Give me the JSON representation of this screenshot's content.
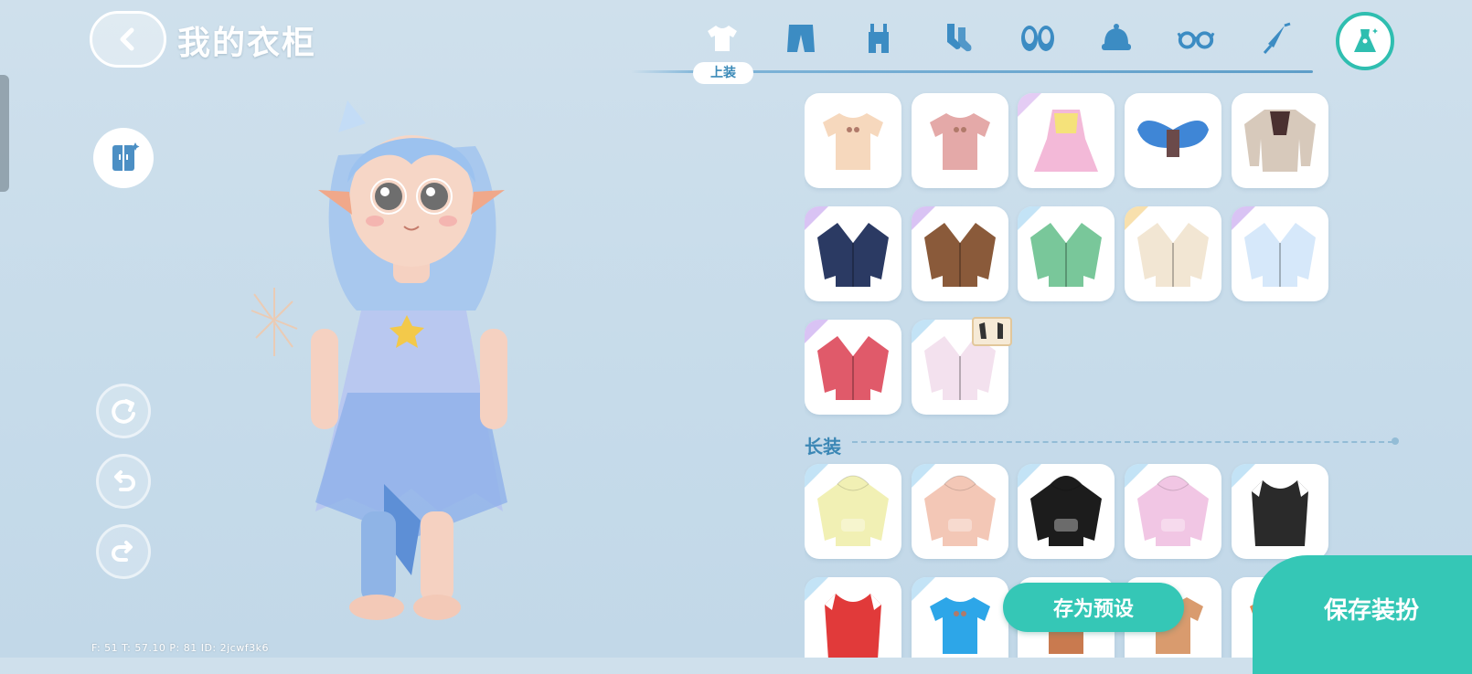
{
  "header": {
    "title": "我的衣柜"
  },
  "tabs": [
    {
      "icon": "shirt-icon",
      "label": "上装",
      "active": true
    },
    {
      "icon": "pants-icon"
    },
    {
      "icon": "overalls-icon"
    },
    {
      "icon": "socks-icon"
    },
    {
      "icon": "shoes-icon"
    },
    {
      "icon": "hat-icon"
    },
    {
      "icon": "glasses-icon"
    },
    {
      "icon": "umbrella-icon"
    },
    {
      "icon": "outfit-icon"
    }
  ],
  "sections": {
    "tops": {
      "label": "上装",
      "items": [
        {
          "kind": "tee",
          "color": "#f6d8bd",
          "corner": null
        },
        {
          "kind": "tee",
          "color": "#e4a9a8",
          "corner": null
        },
        {
          "kind": "dress",
          "color": "#f3b9d8",
          "corner": "#d9b7f0"
        },
        {
          "kind": "wings",
          "color": "#3f86d6",
          "corner": null
        },
        {
          "kind": "sweater",
          "color": "#d7c9bb",
          "corner": null
        },
        {
          "kind": "jacket",
          "color": "#2b3a63",
          "corner": "#c9a9f0"
        },
        {
          "kind": "jacket",
          "color": "#8a5a3a",
          "corner": "#c9a9f0"
        },
        {
          "kind": "jacket",
          "color": "#79c79a",
          "corner": "#a9d7f2"
        },
        {
          "kind": "jacket",
          "color": "#f2e6d3",
          "corner": "#f5d38a"
        },
        {
          "kind": "jacket",
          "color": "#d6e8fa",
          "corner": "#c9a9f0"
        },
        {
          "kind": "jacket",
          "color": "#e05a6a",
          "corner": "#c9a9f0"
        },
        {
          "kind": "jacket",
          "color": "#f3e1ee",
          "corner": "#a9d7f2"
        }
      ]
    },
    "long": {
      "label": "长装",
      "items": [
        {
          "kind": "hoodie",
          "color": "#f1f0b4",
          "corner": "#a9d7f2"
        },
        {
          "kind": "hoodie",
          "color": "#f3c7b6",
          "corner": "#a9d7f2"
        },
        {
          "kind": "hoodie",
          "color": "#1c1c1c",
          "corner": "#a9d7f2"
        },
        {
          "kind": "hoodie",
          "color": "#f1c6e4",
          "corner": "#a9d7f2"
        },
        {
          "kind": "jersey",
          "color": "#2a2a2a",
          "corner": "#a9d7f2"
        },
        {
          "kind": "jersey",
          "color": "#e13a3a",
          "corner": "#a9d7f2"
        },
        {
          "kind": "tee",
          "color": "#2da6e8",
          "corner": "#a9d7f2"
        },
        {
          "kind": "tee",
          "color": "#c97a4f",
          "corner": null
        },
        {
          "kind": "tee",
          "color": "#d99b6e",
          "corner": null
        },
        {
          "kind": "tee",
          "color": "#e7874f",
          "corner": null
        }
      ]
    }
  },
  "buttons": {
    "preset": "存为预设",
    "save": "保存装扮"
  },
  "stats": "F: 51    T: 57.10    P: 81    ID: 2jcwf3k6"
}
